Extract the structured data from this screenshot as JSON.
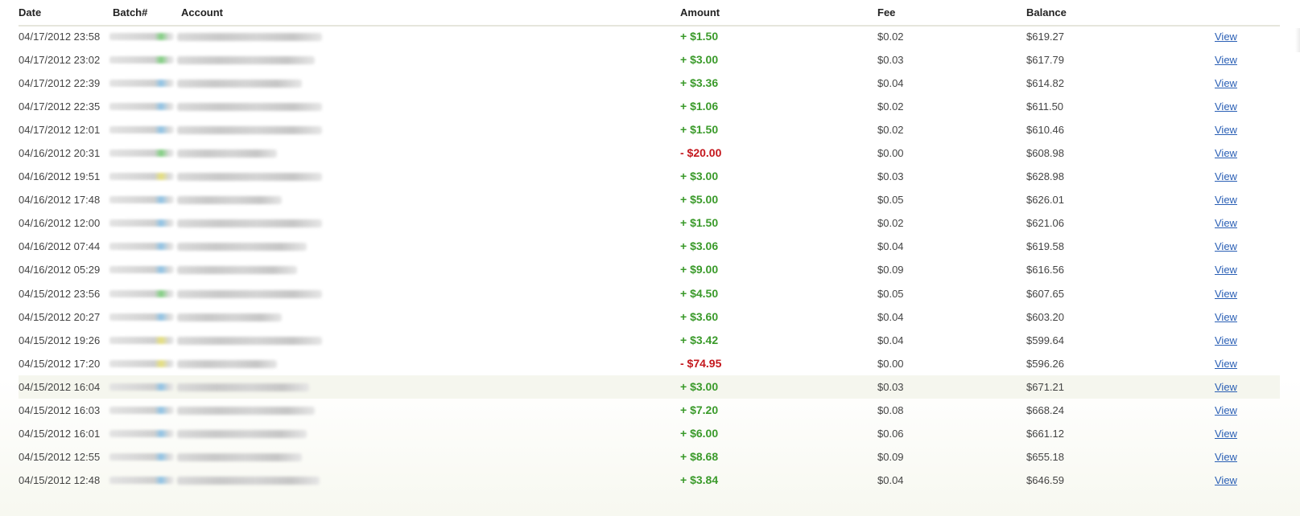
{
  "table": {
    "headers": {
      "date": "Date",
      "batch": "Batch#",
      "account": "Account",
      "amount": "Amount",
      "fee": "Fee",
      "balance": "Balance"
    },
    "rows": [
      {
        "date": "04/17/2012 23:58",
        "amount": "+ $1.50",
        "sign": "pos",
        "fee": "$0.02",
        "balance": "$619.27",
        "view": "View",
        "batch_dot": "#7fcf7f",
        "account_len": 0.58
      },
      {
        "date": "04/17/2012 23:02",
        "amount": "+ $3.00",
        "sign": "pos",
        "fee": "$0.03",
        "balance": "$617.79",
        "view": "View",
        "batch_dot": "#7fcf7f",
        "account_len": 0.55
      },
      {
        "date": "04/17/2012 22:39",
        "amount": "+ $3.36",
        "sign": "pos",
        "fee": "$0.04",
        "balance": "$614.82",
        "view": "View",
        "batch_dot": "#8ec3e6",
        "account_len": 0.5
      },
      {
        "date": "04/17/2012 22:35",
        "amount": "+ $1.06",
        "sign": "pos",
        "fee": "$0.02",
        "balance": "$611.50",
        "view": "View",
        "batch_dot": "#8ec3e6",
        "account_len": 0.58
      },
      {
        "date": "04/17/2012 12:01",
        "amount": "+ $1.50",
        "sign": "pos",
        "fee": "$0.02",
        "balance": "$610.46",
        "view": "View",
        "batch_dot": "#8ec3e6",
        "account_len": 0.58
      },
      {
        "date": "04/16/2012 20:31",
        "amount": "- $20.00",
        "sign": "neg",
        "fee": "$0.00",
        "balance": "$608.98",
        "view": "View",
        "batch_dot": "#7fcf7f",
        "account_len": 0.4
      },
      {
        "date": "04/16/2012 19:51",
        "amount": "+ $3.00",
        "sign": "pos",
        "fee": "$0.03",
        "balance": "$628.98",
        "view": "View",
        "batch_dot": "#e6e07a",
        "account_len": 0.58
      },
      {
        "date": "04/16/2012 17:48",
        "amount": "+ $5.00",
        "sign": "pos",
        "fee": "$0.05",
        "balance": "$626.01",
        "view": "View",
        "batch_dot": "#8ec3e6",
        "account_len": 0.42
      },
      {
        "date": "04/16/2012 12:00",
        "amount": "+ $1.50",
        "sign": "pos",
        "fee": "$0.02",
        "balance": "$621.06",
        "view": "View",
        "batch_dot": "#8ec3e6",
        "account_len": 0.58
      },
      {
        "date": "04/16/2012 07:44",
        "amount": "+ $3.06",
        "sign": "pos",
        "fee": "$0.04",
        "balance": "$619.58",
        "view": "View",
        "batch_dot": "#8ec3e6",
        "account_len": 0.52
      },
      {
        "date": "04/16/2012 05:29",
        "amount": "+ $9.00",
        "sign": "pos",
        "fee": "$0.09",
        "balance": "$616.56",
        "view": "View",
        "batch_dot": "#8ec3e6",
        "account_len": 0.48
      },
      {
        "date": "04/15/2012 23:56",
        "amount": "+ $4.50",
        "sign": "pos",
        "fee": "$0.05",
        "balance": "$607.65",
        "view": "View",
        "batch_dot": "#7fcf7f",
        "account_len": 0.58
      },
      {
        "date": "04/15/2012 20:27",
        "amount": "+ $3.60",
        "sign": "pos",
        "fee": "$0.04",
        "balance": "$603.20",
        "view": "View",
        "batch_dot": "#8ec3e6",
        "account_len": 0.42
      },
      {
        "date": "04/15/2012 19:26",
        "amount": "+ $3.42",
        "sign": "pos",
        "fee": "$0.04",
        "balance": "$599.64",
        "view": "View",
        "batch_dot": "#e6e07a",
        "account_len": 0.58
      },
      {
        "date": "04/15/2012 17:20",
        "amount": "- $74.95",
        "sign": "neg",
        "fee": "$0.00",
        "balance": "$596.26",
        "view": "View",
        "batch_dot": "#e6e07a",
        "account_len": 0.4
      },
      {
        "date": "04/15/2012 16:04",
        "amount": "+ $3.00",
        "sign": "pos",
        "fee": "$0.03",
        "balance": "$671.21",
        "view": "View",
        "batch_dot": "#8ec3e6",
        "account_len": 0.53,
        "highlight": true
      },
      {
        "date": "04/15/2012 16:03",
        "amount": "+ $7.20",
        "sign": "pos",
        "fee": "$0.08",
        "balance": "$668.24",
        "view": "View",
        "batch_dot": "#8ec3e6",
        "account_len": 0.55
      },
      {
        "date": "04/15/2012 16:01",
        "amount": "+ $6.00",
        "sign": "pos",
        "fee": "$0.06",
        "balance": "$661.12",
        "view": "View",
        "batch_dot": "#8ec3e6",
        "account_len": 0.52
      },
      {
        "date": "04/15/2012 12:55",
        "amount": "+ $8.68",
        "sign": "pos",
        "fee": "$0.09",
        "balance": "$655.18",
        "view": "View",
        "batch_dot": "#8ec3e6",
        "account_len": 0.5
      },
      {
        "date": "04/15/2012 12:48",
        "amount": "+ $3.84",
        "sign": "pos",
        "fee": "$0.04",
        "balance": "$646.59",
        "view": "View",
        "batch_dot": "#8ec3e6",
        "account_len": 0.57
      }
    ]
  },
  "colors": {
    "positive": "#3a9a2a",
    "negative": "#c4171d",
    "link": "#2a5fb5",
    "header_rule": "#e6e6dc"
  }
}
